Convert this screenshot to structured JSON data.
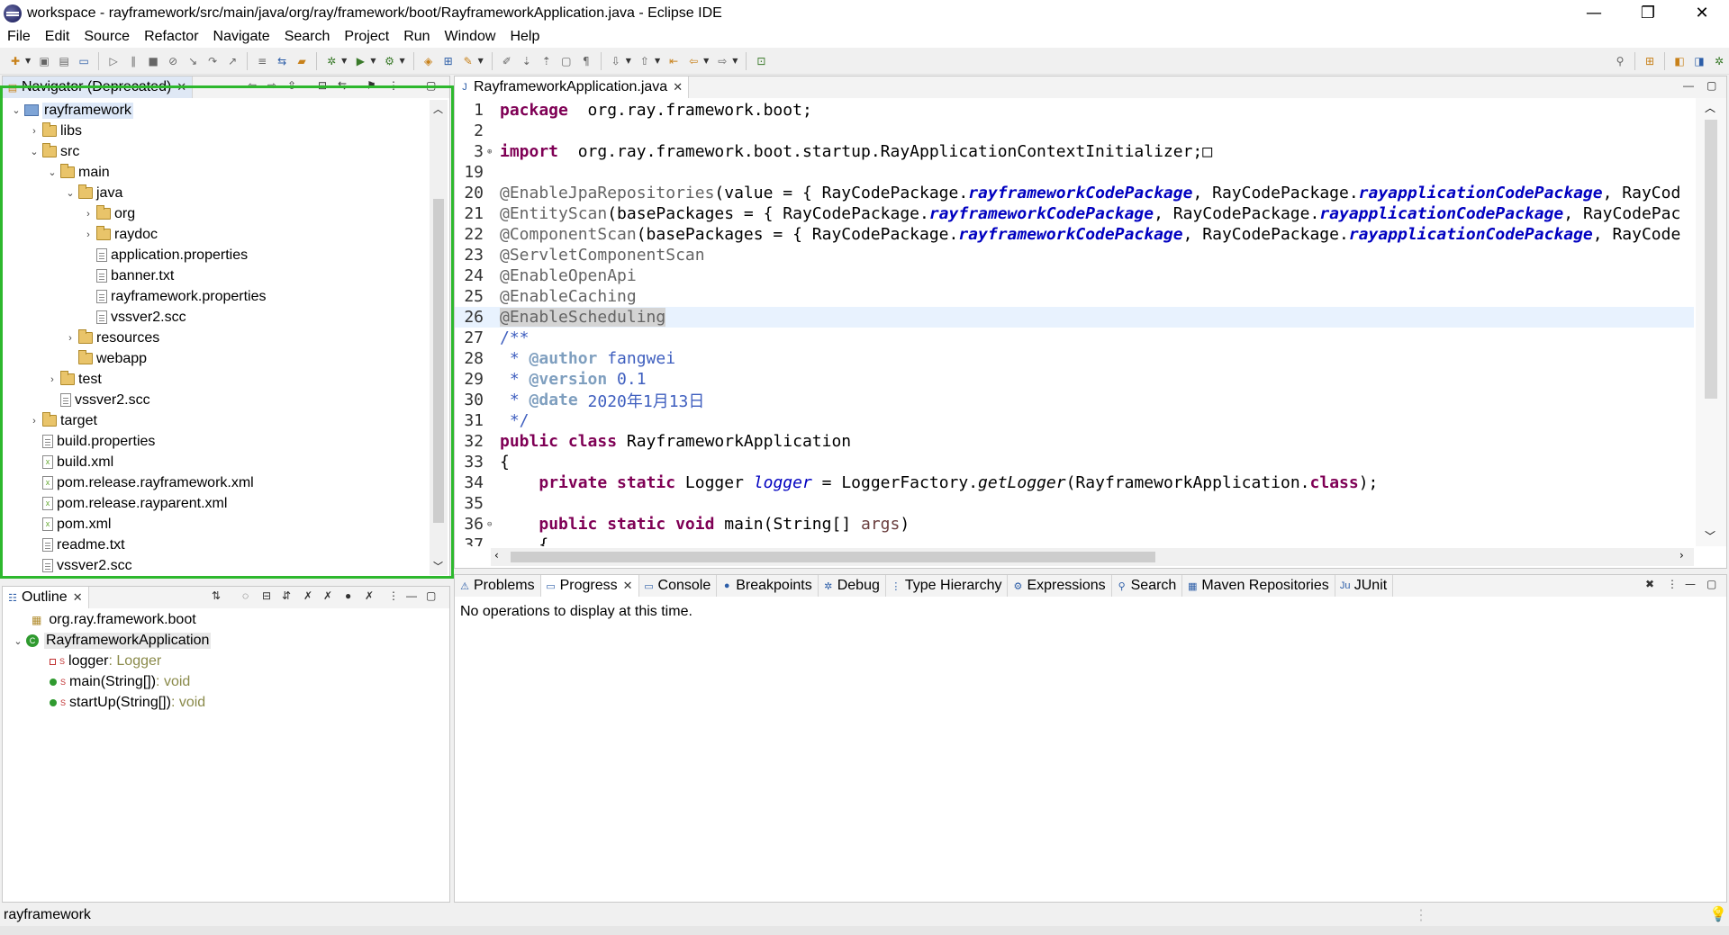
{
  "window": {
    "title": "workspace - rayframework/src/main/java/org/ray/framework/boot/RayframeworkApplication.java - Eclipse IDE",
    "minimize_glyph": "—",
    "maximize_glyph": "❐",
    "close_glyph": "✕"
  },
  "menu": [
    "File",
    "Edit",
    "Source",
    "Refactor",
    "Navigate",
    "Search",
    "Project",
    "Run",
    "Window",
    "Help"
  ],
  "navigator": {
    "tab_label": "Navigator (Deprecated)",
    "tree": [
      {
        "label": "rayframework",
        "depth": 0,
        "twisty": "v",
        "icon": "project"
      },
      {
        "label": "libs",
        "depth": 1,
        "twisty": ">",
        "icon": "folder"
      },
      {
        "label": "src",
        "depth": 1,
        "twisty": "v",
        "icon": "folder"
      },
      {
        "label": "main",
        "depth": 2,
        "twisty": "v",
        "icon": "folder"
      },
      {
        "label": "java",
        "depth": 3,
        "twisty": "v",
        "icon": "folder"
      },
      {
        "label": "org",
        "depth": 4,
        "twisty": ">",
        "icon": "folder"
      },
      {
        "label": "raydoc",
        "depth": 4,
        "twisty": ">",
        "icon": "folder"
      },
      {
        "label": "application.properties",
        "depth": 4,
        "twisty": "",
        "icon": "file"
      },
      {
        "label": "banner.txt",
        "depth": 4,
        "twisty": "",
        "icon": "file"
      },
      {
        "label": "rayframework.properties",
        "depth": 4,
        "twisty": "",
        "icon": "file"
      },
      {
        "label": "vssver2.scc",
        "depth": 4,
        "twisty": "",
        "icon": "file"
      },
      {
        "label": "resources",
        "depth": 3,
        "twisty": ">",
        "icon": "folder"
      },
      {
        "label": "webapp",
        "depth": 3,
        "twisty": "",
        "icon": "folder"
      },
      {
        "label": "test",
        "depth": 2,
        "twisty": ">",
        "icon": "folder"
      },
      {
        "label": "vssver2.scc",
        "depth": 2,
        "twisty": "",
        "icon": "file"
      },
      {
        "label": "target",
        "depth": 1,
        "twisty": ">",
        "icon": "folder"
      },
      {
        "label": "build.properties",
        "depth": 1,
        "twisty": "",
        "icon": "file"
      },
      {
        "label": "build.xml",
        "depth": 1,
        "twisty": "",
        "icon": "xml"
      },
      {
        "label": "pom.release.rayframework.xml",
        "depth": 1,
        "twisty": "",
        "icon": "xml"
      },
      {
        "label": "pom.release.rayparent.xml",
        "depth": 1,
        "twisty": "",
        "icon": "xml"
      },
      {
        "label": "pom.xml",
        "depth": 1,
        "twisty": "",
        "icon": "xml"
      },
      {
        "label": "readme.txt",
        "depth": 1,
        "twisty": "",
        "icon": "file"
      },
      {
        "label": "vssver2.scc",
        "depth": 1,
        "twisty": "",
        "icon": "file"
      }
    ]
  },
  "editor": {
    "tab_label": "RayframeworkApplication.java",
    "lines": [
      {
        "n": "1",
        "parts": [
          [
            "kw",
            "package"
          ],
          [
            "",
            "  org.ray.framework.boot;"
          ]
        ]
      },
      {
        "n": "2",
        "parts": []
      },
      {
        "n": "3",
        "parts": [
          [
            "kw",
            "import"
          ],
          [
            "",
            "  org.ray.framework.boot.startup.RayApplicationContextInitializer;"
          ],
          [
            "",
            "□"
          ]
        ]
      },
      {
        "n": "19",
        "parts": []
      },
      {
        "n": "20",
        "parts": [
          [
            "ann",
            "@EnableJpaRepositories"
          ],
          [
            "",
            "(value = { RayCodePackage."
          ],
          [
            "ital",
            "rayframeworkCodePackage"
          ],
          [
            "",
            ", RayCodePackage."
          ],
          [
            "ital",
            "rayapplicationCodePackage"
          ],
          [
            "",
            ", RayCod"
          ]
        ]
      },
      {
        "n": "21",
        "parts": [
          [
            "ann",
            "@EntityScan"
          ],
          [
            "",
            "(basePackages = { RayCodePackage."
          ],
          [
            "ital",
            "rayframeworkCodePackage"
          ],
          [
            "",
            ", RayCodePackage."
          ],
          [
            "ital",
            "rayapplicationCodePackage"
          ],
          [
            "",
            ", RayCodePac"
          ]
        ]
      },
      {
        "n": "22",
        "parts": [
          [
            "ann",
            "@ComponentScan"
          ],
          [
            "",
            "(basePackages = { RayCodePackage."
          ],
          [
            "ital",
            "rayframeworkCodePackage"
          ],
          [
            "",
            ", RayCodePackage."
          ],
          [
            "ital",
            "rayapplicationCodePackage"
          ],
          [
            "",
            ", RayCode"
          ]
        ]
      },
      {
        "n": "23",
        "parts": [
          [
            "ann",
            "@ServletComponentScan"
          ]
        ]
      },
      {
        "n": "24",
        "parts": [
          [
            "ann",
            "@EnableOpenApi"
          ]
        ]
      },
      {
        "n": "25",
        "parts": [
          [
            "ann",
            "@EnableCaching"
          ]
        ]
      },
      {
        "n": "26",
        "parts": [
          [
            "ann",
            "@EnableScheduling"
          ]
        ],
        "highlight": true
      },
      {
        "n": "27",
        "parts": [
          [
            "cmt",
            "/**"
          ]
        ]
      },
      {
        "n": "28",
        "parts": [
          [
            "cmt",
            " * "
          ],
          [
            "tag",
            "@author"
          ],
          [
            "cmt",
            " fangwei"
          ]
        ]
      },
      {
        "n": "29",
        "parts": [
          [
            "cmt",
            " * "
          ],
          [
            "tag",
            "@version"
          ],
          [
            "cmt",
            " 0.1"
          ]
        ]
      },
      {
        "n": "30",
        "parts": [
          [
            "cmt",
            " * "
          ],
          [
            "tag",
            "@date"
          ],
          [
            "cmt",
            " 2020年1月13日"
          ]
        ]
      },
      {
        "n": "31",
        "parts": [
          [
            "cmt",
            " */"
          ]
        ]
      },
      {
        "n": "32",
        "parts": [
          [
            "kw",
            "public class"
          ],
          [
            "",
            " RayframeworkApplication"
          ]
        ]
      },
      {
        "n": "33",
        "parts": [
          [
            "",
            "{"
          ]
        ]
      },
      {
        "n": "34",
        "parts": [
          [
            "",
            "    "
          ],
          [
            "kw",
            "private static"
          ],
          [
            "",
            " Logger "
          ],
          [
            "fld",
            "logger"
          ],
          [
            "",
            " = LoggerFactory."
          ],
          [
            "ital2",
            "getLogger"
          ],
          [
            "",
            "(RayframeworkApplication."
          ],
          [
            "kw",
            "class"
          ],
          [
            "",
            ");"
          ]
        ]
      },
      {
        "n": "35",
        "parts": []
      },
      {
        "n": "36",
        "parts": [
          [
            "",
            "    "
          ],
          [
            "kw",
            "public static void"
          ],
          [
            "",
            " main(String[] "
          ],
          [
            "arg",
            "args"
          ],
          [
            "",
            ")"
          ]
        ]
      },
      {
        "n": "37",
        "parts": [
          [
            "",
            "    {"
          ]
        ]
      }
    ]
  },
  "outline": {
    "tab_label": "Outline",
    "items": [
      {
        "label": "org.ray.framework.boot",
        "type": "",
        "kind": "package",
        "depth": 1
      },
      {
        "label": "RayframeworkApplication",
        "type": "",
        "kind": "class",
        "depth": 0
      },
      {
        "label": "logger",
        "type": " : Logger",
        "kind": "field",
        "depth": 2
      },
      {
        "label": "main(String[])",
        "type": " : void",
        "kind": "method",
        "depth": 2
      },
      {
        "label": "startUp(String[])",
        "type": " : void",
        "kind": "method",
        "depth": 2
      }
    ]
  },
  "bottom_tabs": [
    {
      "label": "Problems",
      "icon": "⚠"
    },
    {
      "label": "Progress",
      "icon": "▭",
      "active": true
    },
    {
      "label": "Console",
      "icon": "▭"
    },
    {
      "label": "Breakpoints",
      "icon": "●"
    },
    {
      "label": "Debug",
      "icon": "✲"
    },
    {
      "label": "Type Hierarchy",
      "icon": "⋮"
    },
    {
      "label": "Expressions",
      "icon": "⚙"
    },
    {
      "label": "Search",
      "icon": "⚲"
    },
    {
      "label": "Maven Repositories",
      "icon": "▦"
    },
    {
      "label": "JUnit",
      "icon": "Ju"
    }
  ],
  "progress": {
    "message": "No operations to display at this time."
  },
  "status": {
    "text": "rayframework"
  },
  "colors": {
    "highlight_box": "#2db82d",
    "keyword": "#7f0055",
    "annotation": "#646464",
    "static_field": "#0000c0",
    "javadoc": "#3f5fbf"
  }
}
